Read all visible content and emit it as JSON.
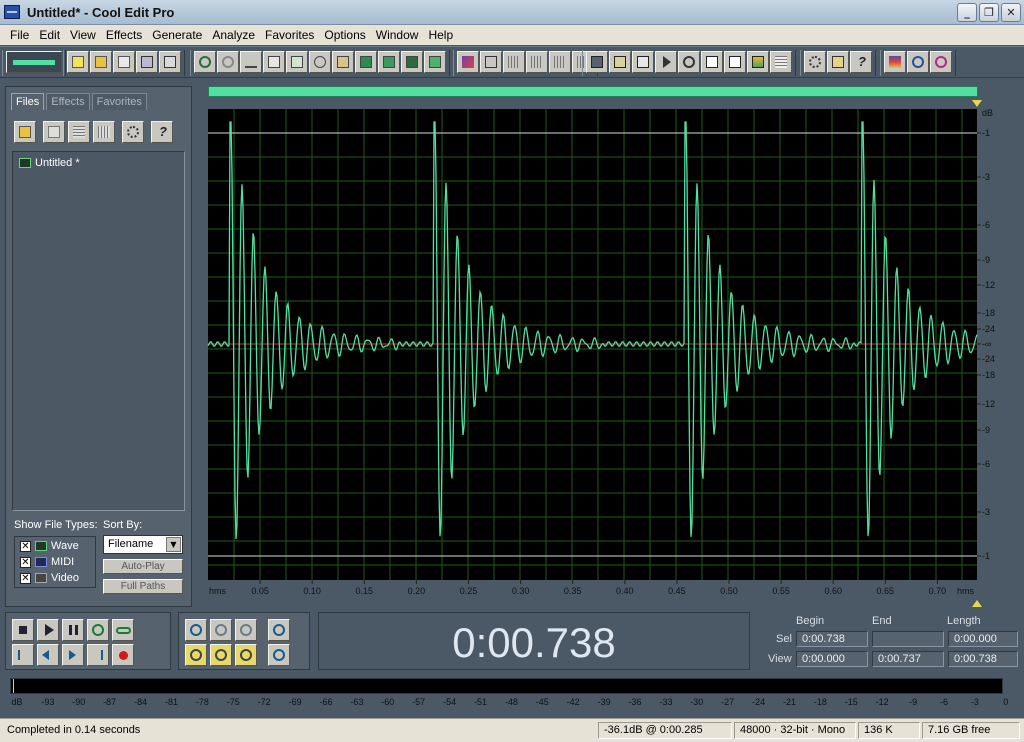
{
  "window": {
    "title": "Untitled* - Cool Edit Pro"
  },
  "menu": [
    "File",
    "Edit",
    "View",
    "Effects",
    "Generate",
    "Analyze",
    "Favorites",
    "Options",
    "Window",
    "Help"
  ],
  "left_panel": {
    "tabs": [
      "Files",
      "Effects",
      "Favorites"
    ],
    "files": [
      "Untitled *"
    ],
    "show_file_types_label": "Show File Types:",
    "sort_by_label": "Sort By:",
    "file_types": [
      {
        "label": "Wave",
        "checked": true
      },
      {
        "label": "MIDI",
        "checked": true
      },
      {
        "label": "Video",
        "checked": true
      }
    ],
    "sort_by_value": "Filename",
    "auto_play": "Auto-Play",
    "full_paths": "Full Paths"
  },
  "waveform": {
    "db_unit": "dB",
    "db_scale": [
      "-1",
      "-3",
      "-6",
      "-9",
      "-12",
      "-18",
      "-24",
      "-∞",
      "-24",
      "-18",
      "-12",
      "-9",
      "-6",
      "-3",
      "-1"
    ],
    "time_unit_left": "hms",
    "time_unit_right": "hms",
    "time_ticks": [
      "0.05",
      "0.10",
      "0.15",
      "0.20",
      "0.25",
      "0.30",
      "0.35",
      "0.40",
      "0.45",
      "0.50",
      "0.55",
      "0.60",
      "0.65",
      "0.70"
    ],
    "wave_color": "#52e0a2",
    "background": "#000000",
    "grid_color": "#1f5a1f"
  },
  "time_display": "0:00.738",
  "selection": {
    "headers": [
      "Begin",
      "End",
      "Length"
    ],
    "sel_label": "Sel",
    "view_label": "View",
    "sel": [
      "0:00.738",
      "",
      "0:00.000"
    ],
    "view": [
      "0:00.000",
      "0:00.737",
      "0:00.738"
    ]
  },
  "level_meter": {
    "labels": [
      "dB",
      "-93",
      "-90",
      "-87",
      "-84",
      "-81",
      "-78",
      "-75",
      "-72",
      "-69",
      "-66",
      "-63",
      "-60",
      "-57",
      "-54",
      "-51",
      "-48",
      "-45",
      "-42",
      "-39",
      "-36",
      "-33",
      "-30",
      "-27",
      "-24",
      "-21",
      "-18",
      "-15",
      "-12",
      "-9",
      "-6",
      "-3",
      "0"
    ]
  },
  "status": {
    "message": "Completed in 0.14 seconds",
    "cursor": "-36.1dB @  0:00.285",
    "format": "48000 · 32-bit · Mono",
    "size": "136 K",
    "free": "7.16 GB free"
  }
}
